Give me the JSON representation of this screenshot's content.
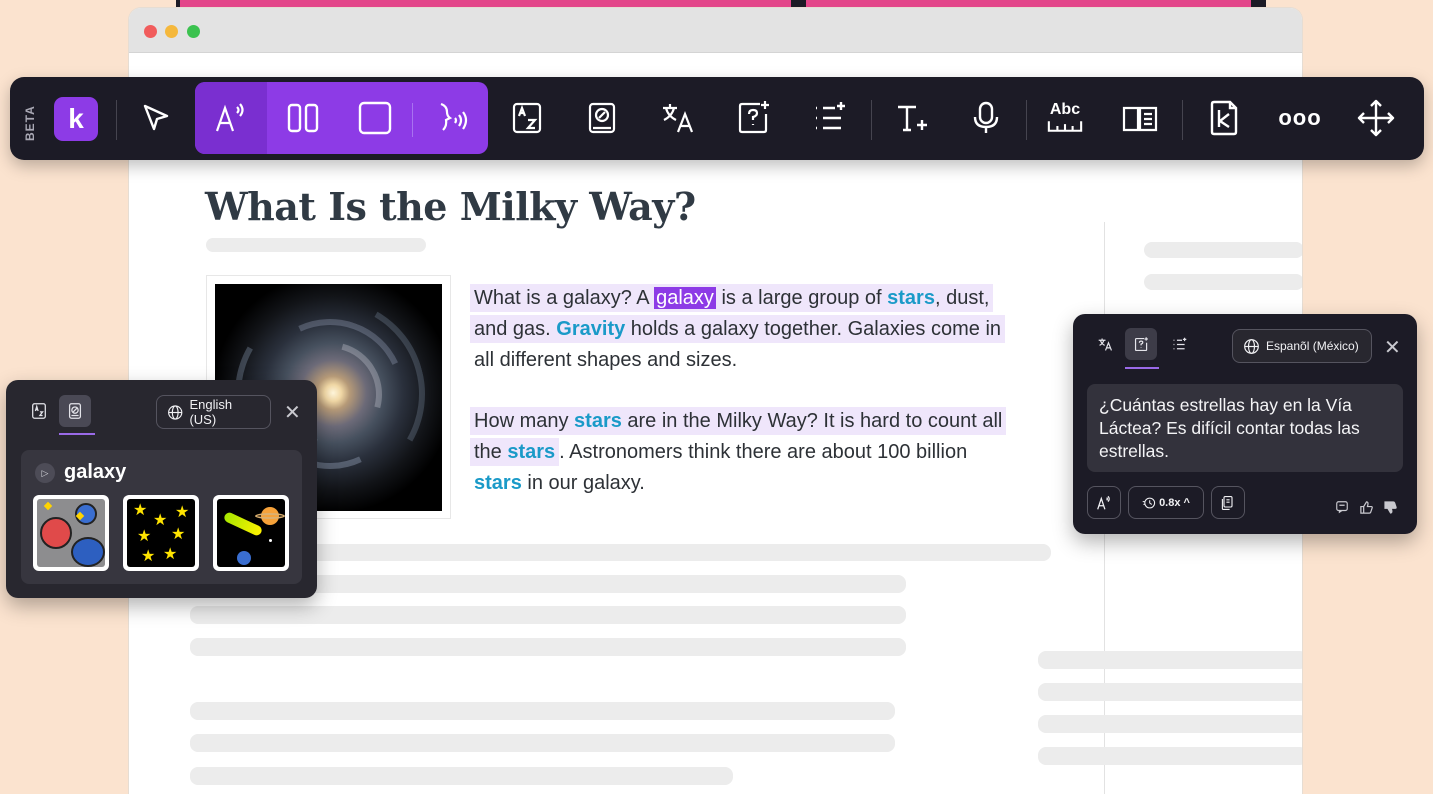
{
  "article": {
    "title": "What Is the Milky Way?",
    "para1": {
      "t1": "What is a galaxy? A ",
      "w_galaxy": "galaxy",
      "t2": " is a large group of ",
      "w_stars": "stars",
      "t3": ", dust,",
      "t4": "and gas. ",
      "w_gravity": "Gravity",
      "t5": " holds a galaxy together. Galaxies come in",
      "t6": "all different shapes and sizes."
    },
    "para2": {
      "t1": "How many ",
      "w_stars1": "stars",
      "t2": " are in the Milky Way? It is hard to count all",
      "t3": "the ",
      "w_stars2": "stars",
      "t4": ". Astronomers think there are about 100 billion",
      "w_stars3": "stars",
      "t5": " in our galaxy."
    }
  },
  "toolbar": {
    "beta_label": "BETA",
    "logo_letter": "k",
    "buttons": [
      "select-tool",
      "read-aloud",
      "screen-mask",
      "screen-ruler",
      "voice",
      "dictionary",
      "picture-dictionary",
      "translate",
      "ask-question",
      "summarize",
      "add-text",
      "microphone",
      "spelling",
      "reader-view",
      "kami-logo",
      "more",
      "move"
    ],
    "abc_label": "Abc",
    "more_glyph": "ooo"
  },
  "word_panel": {
    "language": "English (US)",
    "word": "galaxy",
    "pictures": [
      "planets",
      "stars",
      "comet-and-saturn"
    ]
  },
  "translate_panel": {
    "language": "Espanõl (México)",
    "translation": "¿Cuántas estrellas hay en la Vía Láctea? Es difícil contar todas las estrellas.",
    "speed": "0.8x"
  },
  "colors": {
    "accent": "#8d3be6",
    "keyword": "#1a9ac8",
    "toolbar_bg": "#1c1b26",
    "highlight_bg": "#efe6fb"
  }
}
